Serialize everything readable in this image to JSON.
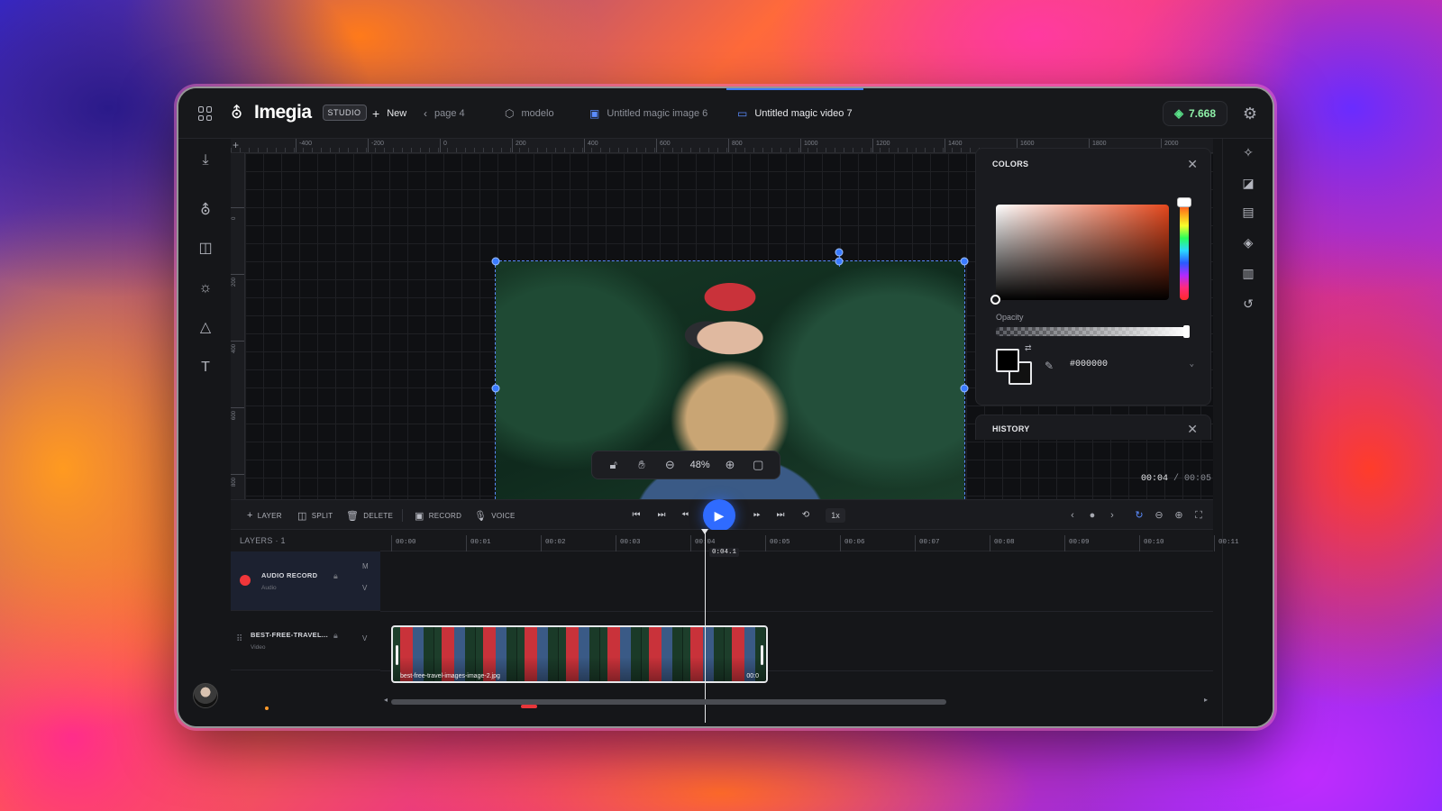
{
  "app": {
    "logo_text": "Imegia",
    "logo_badge": "STUDIO"
  },
  "tabs": {
    "new_label": "New",
    "items": [
      {
        "label": "page 4",
        "icon": "chevron-left-icon"
      },
      {
        "label": "modelo",
        "icon": "cube-icon"
      },
      {
        "label": "Untitled magic image 6",
        "icon": "image-icon"
      },
      {
        "label": "Untitled magic video 7",
        "icon": "video-icon",
        "active": true
      }
    ]
  },
  "credits": "7.668",
  "ruler": {
    "x_labels": [
      "-400",
      "-200",
      "0",
      "200",
      "400",
      "600",
      "800",
      "1000",
      "1200",
      "1400",
      "1600",
      "1800",
      "2000",
      "2200"
    ],
    "y_labels": [
      "0",
      "200",
      "400",
      "600",
      "800"
    ]
  },
  "canvas": {
    "zoom": "48%"
  },
  "time": {
    "current": "00:04",
    "total": "00:05",
    "playhead": "0:04.1"
  },
  "colors_panel": {
    "title": "COLORS",
    "opacity_label": "Opacity",
    "hex": "#000000",
    "hue_color": "#e4471c"
  },
  "history_panel": {
    "title": "HISTORY"
  },
  "toolbar": {
    "layer": "LAYER",
    "split": "SPLIT",
    "delete": "DELETE",
    "record": "RECORD",
    "voice": "VOICE",
    "speed": "1x"
  },
  "timeline": {
    "layers_title": "LAYERS · 1",
    "marks": [
      "00:00",
      "00:01",
      "00:02",
      "00:03",
      "00:04",
      "00:05",
      "00:06",
      "00:07",
      "00:08",
      "00:09",
      "00:10",
      "00:11"
    ],
    "layers": [
      {
        "name": "AUDIO RECORD",
        "type": "Audio",
        "flag_m": "M",
        "flag_v": "V"
      },
      {
        "name": "BEST-FREE-TRAVEL...",
        "type": "Video",
        "flag_v": "V"
      }
    ],
    "clip_label": "best-free-travel-images-image-2.jpg",
    "clip_time": "00:0"
  },
  "accent_color": "#2f6bff"
}
